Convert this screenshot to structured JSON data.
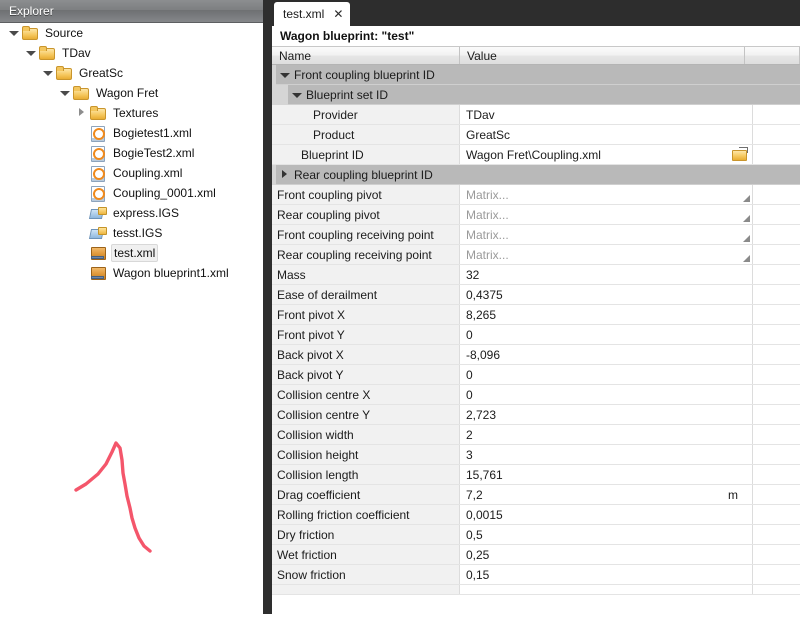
{
  "explorer": {
    "title": "Explorer",
    "tree": [
      {
        "label": "Source",
        "icon": "folder-icon",
        "depth": 0,
        "twisty": "expanded",
        "selected": false
      },
      {
        "label": "TDav",
        "icon": "folder-icon",
        "depth": 1,
        "twisty": "expanded",
        "selected": false
      },
      {
        "label": "GreatSc",
        "icon": "folder-icon",
        "depth": 2,
        "twisty": "expanded",
        "selected": false
      },
      {
        "label": "Wagon Fret",
        "icon": "folder-icon",
        "depth": 3,
        "twisty": "expanded",
        "selected": false
      },
      {
        "label": "Textures",
        "icon": "folder-icon",
        "depth": 4,
        "twisty": "collapsed",
        "selected": false
      },
      {
        "label": "Bogietest1.xml",
        "icon": "xml-document-icon",
        "depth": 4,
        "twisty": "none",
        "selected": false
      },
      {
        "label": "BogieTest2.xml",
        "icon": "xml-document-icon",
        "depth": 4,
        "twisty": "none",
        "selected": false
      },
      {
        "label": "Coupling.xml",
        "icon": "xml-document-icon",
        "depth": 4,
        "twisty": "none",
        "selected": false
      },
      {
        "label": "Coupling_0001.xml",
        "icon": "xml-document-icon",
        "depth": 4,
        "twisty": "none",
        "selected": false
      },
      {
        "label": "express.IGS",
        "icon": "igs-model-icon",
        "depth": 4,
        "twisty": "none",
        "selected": false
      },
      {
        "label": "tesst.IGS",
        "icon": "igs-model-icon",
        "depth": 4,
        "twisty": "none",
        "selected": false
      },
      {
        "label": "test.xml",
        "icon": "blueprint-box-icon",
        "depth": 4,
        "twisty": "none",
        "selected": true
      },
      {
        "label": "Wagon blueprint1.xml",
        "icon": "blueprint-box-icon",
        "depth": 4,
        "twisty": "none",
        "selected": false
      }
    ],
    "annotation_color": "#f4566b"
  },
  "editor": {
    "tab": {
      "label": "test.xml",
      "close": "✕"
    },
    "document_title": "Wagon blueprint: \"test\"",
    "columns": [
      "Name",
      "Value",
      ""
    ],
    "rows": [
      {
        "kind": "group",
        "name": "Front coupling blueprint ID",
        "level": 1,
        "state": "expanded"
      },
      {
        "kind": "group",
        "name": "Blueprint set ID",
        "level": 2,
        "state": "expanded"
      },
      {
        "kind": "prop",
        "name": "Provider",
        "value": "TDav",
        "level": 3
      },
      {
        "kind": "prop",
        "name": "Product",
        "value": "GreatSc",
        "level": 3
      },
      {
        "kind": "prop",
        "name": "Blueprint ID",
        "value": "Wagon Fret\\Coupling.xml",
        "level": 2,
        "widget": "browse-folder"
      },
      {
        "kind": "group",
        "name": "Rear coupling blueprint ID",
        "level": 1,
        "state": "collapsed"
      },
      {
        "kind": "prop",
        "name": "Front coupling pivot",
        "value": "Matrix...",
        "level": 0,
        "placeholder": true,
        "widget": "resize-grip"
      },
      {
        "kind": "prop",
        "name": "Rear coupling pivot",
        "value": "Matrix...",
        "level": 0,
        "placeholder": true,
        "widget": "resize-grip"
      },
      {
        "kind": "prop",
        "name": "Front coupling receiving point",
        "value": "Matrix...",
        "level": 0,
        "placeholder": true,
        "widget": "resize-grip"
      },
      {
        "kind": "prop",
        "name": "Rear coupling receiving point",
        "value": "Matrix...",
        "level": 0,
        "placeholder": true,
        "widget": "resize-grip"
      },
      {
        "kind": "prop",
        "name": "Mass",
        "value": "32",
        "level": 0
      },
      {
        "kind": "prop",
        "name": "Ease of derailment",
        "value": "0,4375",
        "level": 0
      },
      {
        "kind": "prop",
        "name": "Front pivot X",
        "value": "8,265",
        "level": 0
      },
      {
        "kind": "prop",
        "name": "Front pivot Y",
        "value": "0",
        "level": 0
      },
      {
        "kind": "prop",
        "name": "Back pivot X",
        "value": "-8,096",
        "level": 0
      },
      {
        "kind": "prop",
        "name": "Back pivot Y",
        "value": "0",
        "level": 0
      },
      {
        "kind": "prop",
        "name": "Collision centre X",
        "value": "0",
        "level": 0
      },
      {
        "kind": "prop",
        "name": "Collision centre Y",
        "value": "2,723",
        "level": 0
      },
      {
        "kind": "prop",
        "name": "Collision width",
        "value": "2",
        "level": 0
      },
      {
        "kind": "prop",
        "name": "Collision height",
        "value": "3",
        "level": 0
      },
      {
        "kind": "prop",
        "name": "Collision length",
        "value": "15,761",
        "level": 0
      },
      {
        "kind": "prop",
        "name": "Drag coefficient",
        "value": "7,2",
        "level": 0,
        "unit": "m"
      },
      {
        "kind": "prop",
        "name": "Rolling friction coefficient",
        "value": "0,0015",
        "level": 0
      },
      {
        "kind": "prop",
        "name": "Dry friction",
        "value": "0,5",
        "level": 0
      },
      {
        "kind": "prop",
        "name": "Wet friction",
        "value": "0,25",
        "level": 0
      },
      {
        "kind": "prop",
        "name": "Snow friction",
        "value": "0,15",
        "level": 0
      },
      {
        "kind": "prop",
        "name": "",
        "value": "",
        "level": 0,
        "clipped": true
      }
    ]
  }
}
